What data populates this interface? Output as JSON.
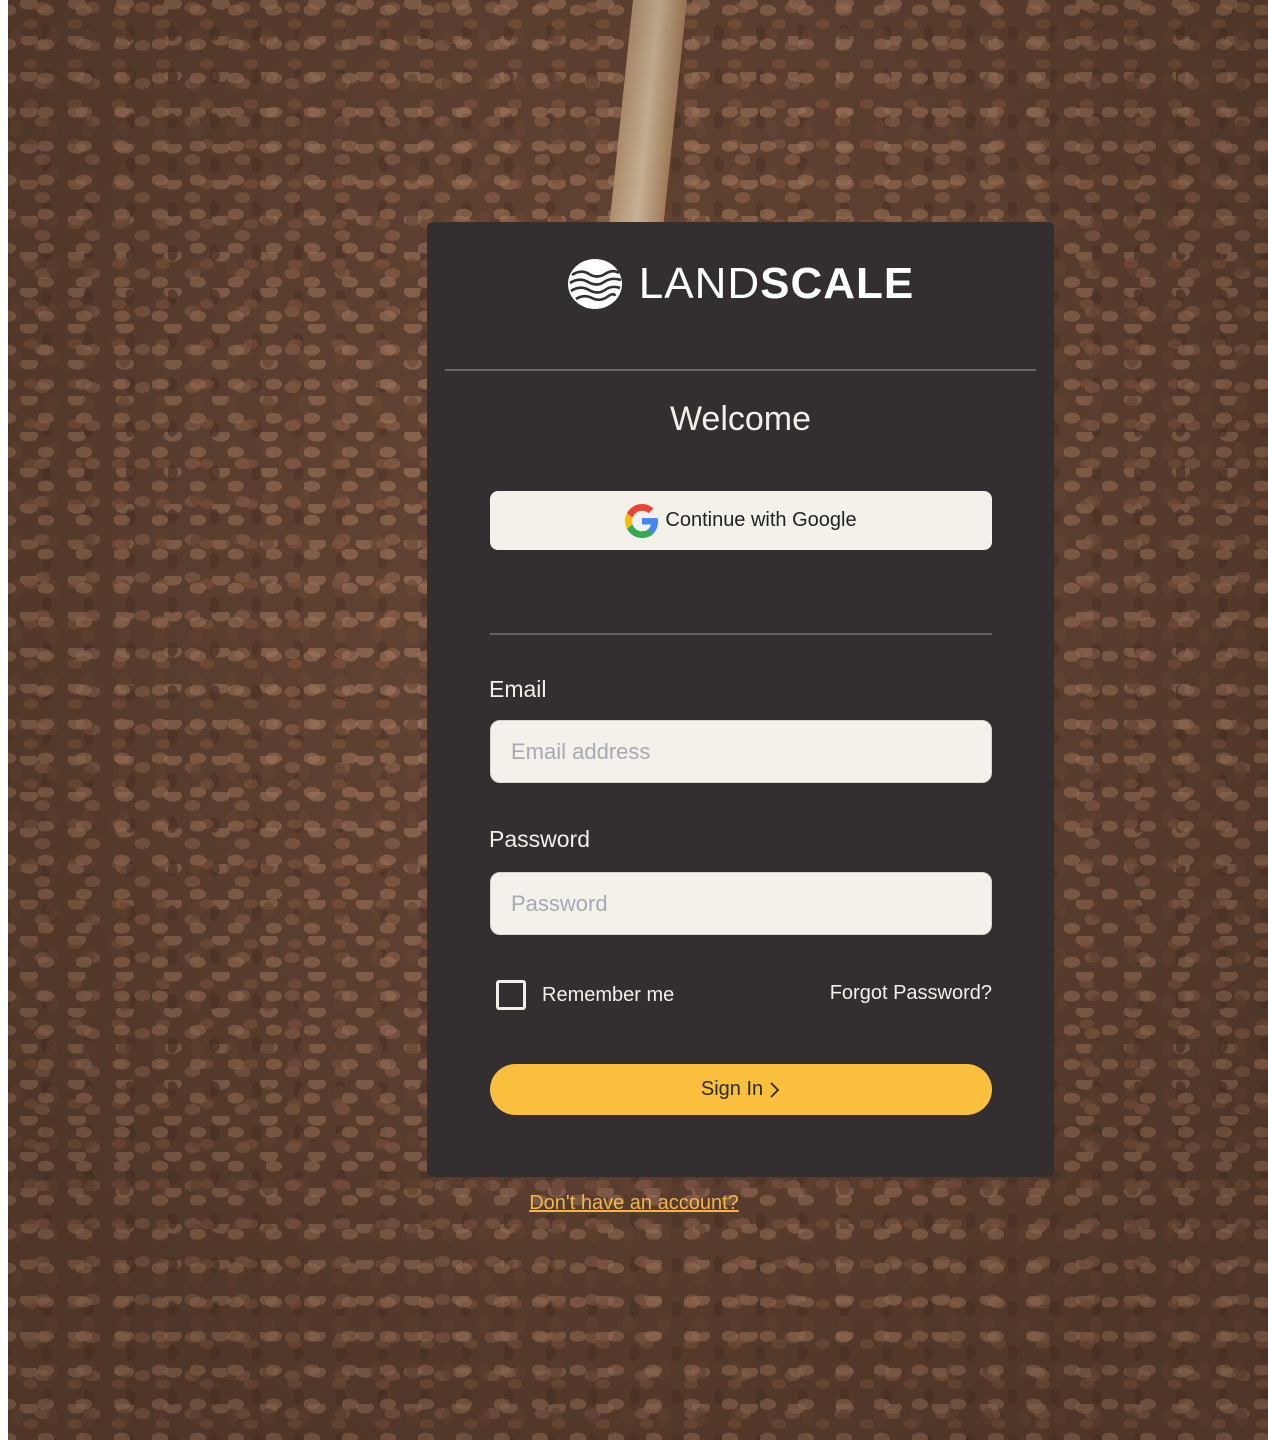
{
  "brand": {
    "name_light": "LAND",
    "name_bold": "SCALE",
    "logo_icon": "landscale-wave-logo-icon"
  },
  "card": {
    "heading": "Welcome",
    "google_button": {
      "label": "Continue with Google",
      "icon": "google-g-icon"
    },
    "email": {
      "label": "Email",
      "placeholder": "Email address",
      "value": ""
    },
    "password": {
      "label": "Password",
      "placeholder": "Password",
      "value": ""
    },
    "remember_me": {
      "label": "Remember me",
      "checked": false
    },
    "forgot_password": "Forgot Password?",
    "sign_in": {
      "label": "Sign In",
      "icon": "chevron-right-icon"
    }
  },
  "signup_link": "Don't have an account?",
  "colors": {
    "card_bg": "#332e2f",
    "accent": "#fbbf3e",
    "link": "#f3b54a",
    "input_bg": "#f3f1ea"
  }
}
